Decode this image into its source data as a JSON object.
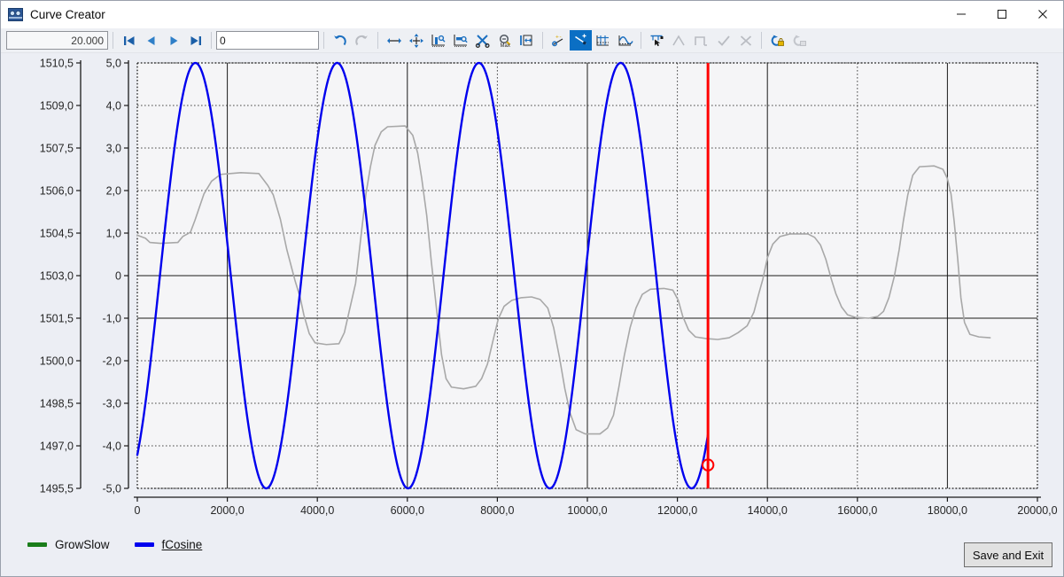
{
  "window": {
    "title": "Curve Creator",
    "icon": "curve-creator-icon",
    "minimize": "—",
    "maximize": "☐",
    "close": "✕"
  },
  "toolbar": {
    "step_value": "20.000",
    "index_value": "0",
    "index_placeholder": "0",
    "buttons": [
      {
        "name": "first-frame-button",
        "icon": "skip-to-start-icon",
        "enabled": true
      },
      {
        "name": "previous-frame-button",
        "icon": "step-back-icon",
        "enabled": true
      },
      {
        "name": "next-frame-button",
        "icon": "step-forward-icon",
        "enabled": true
      },
      {
        "name": "last-frame-button",
        "icon": "skip-to-end-icon",
        "enabled": true
      },
      {
        "name": "undo-button",
        "icon": "undo-icon",
        "enabled": true
      },
      {
        "name": "redo-button",
        "icon": "redo-icon",
        "enabled": false
      },
      {
        "name": "pan-horizontal-button",
        "icon": "pan-horizontal-icon",
        "enabled": true
      },
      {
        "name": "pan-free-button",
        "icon": "pan-free-icon",
        "enabled": true
      },
      {
        "name": "fit-y-axis-button",
        "icon": "fit-vertical-icon",
        "enabled": true
      },
      {
        "name": "fit-x-axis-button",
        "icon": "fit-horizontal-icon",
        "enabled": true
      },
      {
        "name": "cut-curve-button",
        "icon": "scissors-icon",
        "enabled": true
      },
      {
        "name": "zoom-max-button",
        "icon": "zoom-max-icon",
        "enabled": true
      },
      {
        "name": "zoom-range-button",
        "icon": "zoom-range-icon",
        "enabled": true
      },
      {
        "name": "add-point-button",
        "icon": "add-point-icon",
        "enabled": true
      },
      {
        "name": "line-segment-button",
        "icon": "line-segment-icon",
        "enabled": true,
        "active": true
      },
      {
        "name": "grid-snap-button",
        "icon": "grid-snap-icon",
        "enabled": true
      },
      {
        "name": "smooth-curve-button",
        "icon": "smooth-curve-icon",
        "enabled": true
      },
      {
        "name": "select-point-button",
        "icon": "select-point-icon",
        "enabled": true
      },
      {
        "name": "ramp-shape-button",
        "icon": "ramp-shape-icon",
        "enabled": false
      },
      {
        "name": "pulse-shape-button",
        "icon": "pulse-shape-icon",
        "enabled": false
      },
      {
        "name": "accept-button",
        "icon": "check-icon",
        "enabled": false
      },
      {
        "name": "reject-button",
        "icon": "cross-icon",
        "enabled": false
      },
      {
        "name": "lock-curve-button",
        "icon": "lock-curve-icon",
        "enabled": true
      },
      {
        "name": "unlock-curve-button",
        "icon": "unlock-curve-icon",
        "enabled": false
      }
    ]
  },
  "chart_data": {
    "type": "line",
    "title": "",
    "xlabel": "",
    "ylabel": "",
    "grid": true,
    "legend_position": "bottom-left",
    "xlim": [
      0,
      20000
    ],
    "x_ticks": [
      0,
      2000,
      4000,
      6000,
      8000,
      10000,
      12000,
      14000,
      16000,
      18000,
      20000
    ],
    "x_tick_labels": [
      "0",
      "2000,0",
      "4000,0",
      "6000,0",
      "8000,0",
      "10000,0",
      "12000,0",
      "14000,0",
      "16000,0",
      "18000,0",
      "20000,0"
    ],
    "x_gridline_styles": [
      "solid",
      "dotted",
      "solid",
      "dotted",
      "solid",
      "dotted",
      "solid",
      "dotted",
      "solid"
    ],
    "axes": [
      {
        "id": "left-outer-axis",
        "name": "GrowSlow",
        "ylim": [
          1495.5,
          1510.5
        ],
        "ticks": [
          1510.5,
          1509.0,
          1507.5,
          1506.0,
          1504.5,
          1503.0,
          1501.5,
          1500.0,
          1498.5,
          1497.0,
          1495.5
        ],
        "tick_labels": [
          "1510,5",
          "1509,0",
          "1507,5",
          "1506,0",
          "1504,5",
          "1503,0",
          "1501,5",
          "1500,0",
          "1498,5",
          "1497,0",
          "1495,5"
        ]
      },
      {
        "id": "left-inner-axis",
        "name": "fCosine",
        "ylim": [
          -5.0,
          5.0
        ],
        "ticks": [
          5.0,
          4.0,
          3.0,
          2.0,
          1.0,
          0,
          -1.0,
          -2.0,
          -3.0,
          -4.0,
          -5.0
        ],
        "tick_labels": [
          "5,0",
          "4,0",
          "3,0",
          "2,0",
          "1,0",
          "0",
          "-1,0",
          "-2,0",
          "-3,0",
          "-4,0",
          "-5,0"
        ],
        "solid_gridlines": [
          0,
          -1.0
        ]
      }
    ],
    "series": [
      {
        "name": "fCosine",
        "color": "#0000ee",
        "axis": "left-inner-axis",
        "width": 2.4,
        "type": "cosine",
        "amplitude": 5.0,
        "period": 3150,
        "phase_x": 1290,
        "offset": 0.0,
        "x_start": 0,
        "x_end": 12680,
        "end_marker": {
          "shape": "circle",
          "color": "#ff0000",
          "x": 12680,
          "y": -4.45
        }
      },
      {
        "name": "GrowSlow",
        "color": "#a8a8a8",
        "axis": "left-inner-axis",
        "width": 1.6,
        "type": "stepped-wave",
        "points": [
          [
            0,
            0.95
          ],
          [
            180,
            0.88
          ],
          [
            280,
            0.78
          ],
          [
            520,
            0.76
          ],
          [
            900,
            0.78
          ],
          [
            1010,
            0.92
          ],
          [
            1180,
            1.02
          ],
          [
            1280,
            1.3
          ],
          [
            1480,
            1.92
          ],
          [
            1650,
            2.22
          ],
          [
            1850,
            2.38
          ],
          [
            2300,
            2.42
          ],
          [
            2700,
            2.4
          ],
          [
            2900,
            2.12
          ],
          [
            3020,
            1.9
          ],
          [
            3180,
            1.32
          ],
          [
            3320,
            0.62
          ],
          [
            3500,
            -0.1
          ],
          [
            3620,
            -0.52
          ],
          [
            3700,
            -0.92
          ],
          [
            3820,
            -1.36
          ],
          [
            3950,
            -1.58
          ],
          [
            4200,
            -1.62
          ],
          [
            4480,
            -1.6
          ],
          [
            4600,
            -1.34
          ],
          [
            4720,
            -0.78
          ],
          [
            4850,
            -0.18
          ],
          [
            4980,
            1.02
          ],
          [
            5080,
            1.92
          ],
          [
            5180,
            2.56
          ],
          [
            5280,
            3.06
          ],
          [
            5420,
            3.38
          ],
          [
            5560,
            3.5
          ],
          [
            5950,
            3.52
          ],
          [
            6120,
            3.3
          ],
          [
            6230,
            2.88
          ],
          [
            6320,
            2.28
          ],
          [
            6430,
            1.42
          ],
          [
            6530,
            0.36
          ],
          [
            6650,
            -0.8
          ],
          [
            6760,
            -1.86
          ],
          [
            6860,
            -2.42
          ],
          [
            6980,
            -2.62
          ],
          [
            7250,
            -2.66
          ],
          [
            7520,
            -2.6
          ],
          [
            7650,
            -2.42
          ],
          [
            7780,
            -2.08
          ],
          [
            7900,
            -1.54
          ],
          [
            8020,
            -1.02
          ],
          [
            8150,
            -0.72
          ],
          [
            8320,
            -0.58
          ],
          [
            8520,
            -0.52
          ],
          [
            8760,
            -0.5
          ],
          [
            8950,
            -0.56
          ],
          [
            9120,
            -0.76
          ],
          [
            9250,
            -1.22
          ],
          [
            9380,
            -1.92
          ],
          [
            9500,
            -2.66
          ],
          [
            9620,
            -3.24
          ],
          [
            9750,
            -3.62
          ],
          [
            9950,
            -3.72
          ],
          [
            10280,
            -3.72
          ],
          [
            10450,
            -3.58
          ],
          [
            10580,
            -3.28
          ],
          [
            10700,
            -2.62
          ],
          [
            10820,
            -1.88
          ],
          [
            10950,
            -1.22
          ],
          [
            11080,
            -0.76
          ],
          [
            11220,
            -0.44
          ],
          [
            11400,
            -0.32
          ],
          [
            11700,
            -0.3
          ],
          [
            11900,
            -0.34
          ],
          [
            12020,
            -0.58
          ],
          [
            12120,
            -0.96
          ],
          [
            12250,
            -1.28
          ],
          [
            12400,
            -1.44
          ],
          [
            12650,
            -1.48
          ],
          [
            12900,
            -1.5
          ],
          [
            13150,
            -1.46
          ],
          [
            13350,
            -1.34
          ],
          [
            13550,
            -1.18
          ],
          [
            13700,
            -0.86
          ],
          [
            13800,
            -0.46
          ],
          [
            13900,
            -0.08
          ],
          [
            14000,
            0.42
          ],
          [
            14120,
            0.74
          ],
          [
            14280,
            0.92
          ],
          [
            14500,
            0.98
          ],
          [
            14900,
            0.98
          ],
          [
            15050,
            0.9
          ],
          [
            15180,
            0.72
          ],
          [
            15300,
            0.38
          ],
          [
            15420,
            -0.08
          ],
          [
            15520,
            -0.42
          ],
          [
            15650,
            -0.74
          ],
          [
            15780,
            -0.92
          ],
          [
            15950,
            -0.98
          ],
          [
            16250,
            -1.0
          ],
          [
            16450,
            -0.96
          ],
          [
            16580,
            -0.84
          ],
          [
            16700,
            -0.52
          ],
          [
            16820,
            -0.02
          ],
          [
            16930,
            0.62
          ],
          [
            17020,
            1.28
          ],
          [
            17120,
            1.9
          ],
          [
            17230,
            2.36
          ],
          [
            17380,
            2.56
          ],
          [
            17700,
            2.58
          ],
          [
            17900,
            2.5
          ],
          [
            18000,
            2.28
          ],
          [
            18080,
            1.92
          ],
          [
            18150,
            1.28
          ],
          [
            18230,
            0.38
          ],
          [
            18300,
            -0.52
          ],
          [
            18380,
            -1.1
          ],
          [
            18500,
            -1.38
          ],
          [
            18700,
            -1.44
          ],
          [
            18950,
            -1.46
          ]
        ]
      }
    ],
    "cursor": {
      "name": "time-cursor",
      "color": "#ff0000",
      "x": 12680,
      "width": 3
    }
  },
  "legend": {
    "items": [
      {
        "name": "legend-item-growslow",
        "label": "GrowSlow",
        "color": "#1a7d1a",
        "selected": false
      },
      {
        "name": "legend-item-fcosine",
        "label": "fCosine",
        "color": "#0000ee",
        "selected": true
      }
    ]
  },
  "footer": {
    "save_label": "Save and Exit"
  }
}
